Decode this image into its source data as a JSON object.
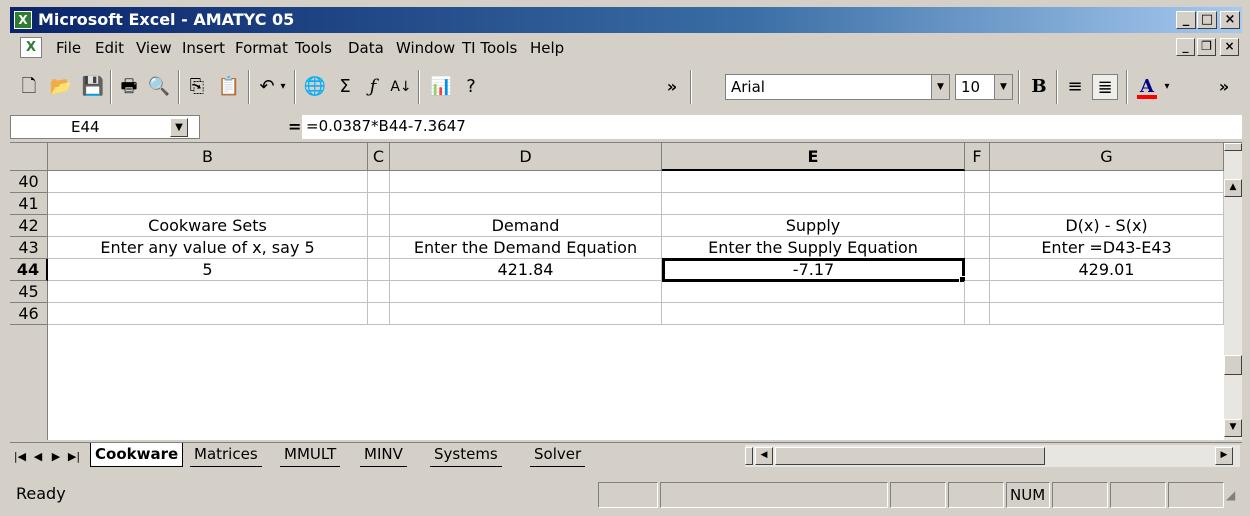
{
  "titlebar": {
    "icon_letter": "X",
    "title": "Microsoft Excel - AMATYC 05",
    "minimize": "_",
    "maximize": "□",
    "close": "×"
  },
  "menubar": {
    "doc_icon_letter": "X",
    "items": [
      "File",
      "Edit",
      "View",
      "Insert",
      "Format",
      "Tools",
      "Data",
      "Window",
      "TI Tools",
      "Help"
    ],
    "doc_minimize": "_",
    "doc_restore": "❐",
    "doc_close": "×"
  },
  "toolbar": {
    "font_name": "Arial",
    "font_size": "10",
    "bold": "B",
    "font_color_letter": "A",
    "more_left": "»",
    "more_right": "»",
    "icons": [
      "new-icon",
      "open-icon",
      "save-icon",
      "print-icon",
      "print-preview-icon",
      "copy-icon",
      "paste-icon",
      "undo-icon",
      "web-icon",
      "autosum-icon",
      "function-icon",
      "sort-ascending-icon",
      "chart-wizard-icon",
      "help-icon",
      "align-left-icon",
      "center-icon",
      "font-color-icon"
    ],
    "colors": {
      "font_color_bar": "#ff0000"
    }
  },
  "formula_bar": {
    "name_box": "E44",
    "equals": "=",
    "formula": "=0.0387*B44-7.3647"
  },
  "grid": {
    "columns": [
      "B",
      "C",
      "D",
      "E",
      "F",
      "G"
    ],
    "rows": [
      "40",
      "41",
      "42",
      "43",
      "44",
      "45",
      "46"
    ],
    "cells": {
      "B42": "Cookware Sets",
      "D42": "Demand",
      "E42": "Supply",
      "G42": "D(x) - S(x)",
      "B43": "Enter any value of x, say 5",
      "D43": "Enter the Demand Equation",
      "E43": "Enter the Supply Equation",
      "G43": "Enter =D43-E43",
      "B44": "5",
      "D44": "421.84",
      "E44": "-7.17",
      "G44": "429.01"
    },
    "active_cell": "E44"
  },
  "sheet_tabs": {
    "tabs": [
      "Cookware",
      "Matrices",
      "MMULT",
      "MINV",
      "Systems",
      "Solver"
    ],
    "active": "Cookware"
  },
  "statusbar": {
    "status": "Ready",
    "num": "NUM"
  }
}
